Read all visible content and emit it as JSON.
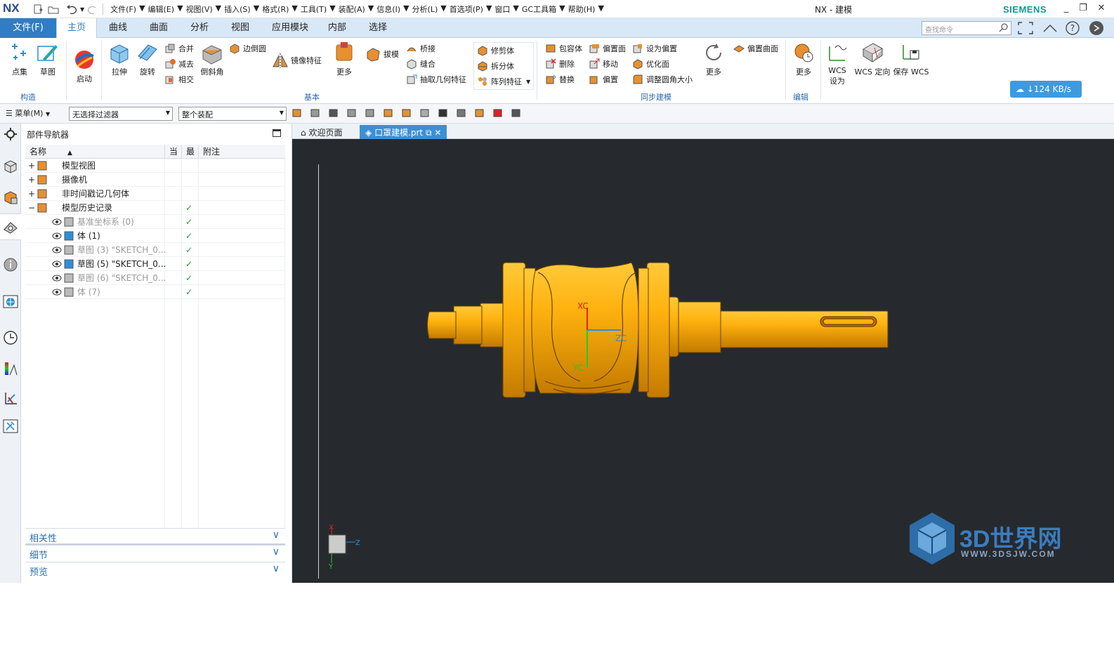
{
  "app": {
    "logo": "NX",
    "window_title": "NX - 建模",
    "brand": "SIEMENS"
  },
  "menu": [
    {
      "label": "文件(F)"
    },
    {
      "label": "编辑(E)"
    },
    {
      "label": "视图(V)"
    },
    {
      "label": "插入(S)"
    },
    {
      "label": "格式(R)"
    },
    {
      "label": "工具(T)"
    },
    {
      "label": "装配(A)"
    },
    {
      "label": "信息(I)"
    },
    {
      "label": "分析(L)"
    },
    {
      "label": "首选项(P)"
    },
    {
      "label": "窗口"
    },
    {
      "label": "GC工具箱"
    },
    {
      "label": "帮助(H)"
    }
  ],
  "tabs": [
    "文件(F)",
    "主页",
    "曲线",
    "曲面",
    "分析",
    "视图",
    "应用模块",
    "内部",
    "选择"
  ],
  "active_tab": "主页",
  "search": {
    "placeholder": "查找命令"
  },
  "ribbon": {
    "construct": {
      "point": "点集",
      "sketch": "草图",
      "group": "构造"
    },
    "launch": "启动",
    "base": {
      "extrude": "拉伸",
      "revolve": "旋转",
      "unite": "合并",
      "subtract": "减去",
      "intersect": "相交",
      "chamfer": "倒斜角",
      "edge_blend": "边倒圆",
      "mirror": "镜像特征",
      "more": "更多",
      "draft": "拔模",
      "bridge": "桥接",
      "sew": "缝合",
      "extract": "抽取几何特征",
      "trim": "修剪体",
      "split": "拆分体",
      "pattern": "阵列特征",
      "group": "基本"
    },
    "sync": {
      "wrap": "包容体",
      "offset_face": "偏置面",
      "set_offset": "设为偏置",
      "delete": "删除",
      "move": "移动",
      "optimize": "优化面",
      "replace": "替换",
      "offset": "偏置",
      "resize_blend": "调整圆角大小",
      "more": "更多",
      "offset_surface": "偏置曲面",
      "group": "同步建模"
    },
    "edit": {
      "more": "更多",
      "group": "编辑"
    },
    "wcs": {
      "set": "WCS 设为",
      "orient": "WCS 定向",
      "save": "保存 WCS"
    }
  },
  "netspeed": "124 KB/s",
  "toolbar2": {
    "menu": "菜单(M)",
    "filter": "无选择过滤器",
    "scope": "整个装配"
  },
  "navigator": {
    "title": "部件导航器",
    "columns": [
      "名称",
      "当",
      "最",
      "附注"
    ],
    "rows": [
      {
        "expander": "+",
        "name": "模型视图",
        "muted": false,
        "latest": false,
        "indent": 0
      },
      {
        "expander": "+",
        "name": "摄像机",
        "muted": false,
        "latest": false,
        "indent": 0
      },
      {
        "expander": "+",
        "name": "非时间戳记几何体",
        "muted": false,
        "latest": false,
        "indent": 0
      },
      {
        "expander": "−",
        "name": "模型历史记录",
        "muted": false,
        "latest": true,
        "indent": 0
      },
      {
        "expander": "",
        "name": "基准坐标系 (0)",
        "muted": true,
        "latest": true,
        "indent": 1
      },
      {
        "expander": "",
        "name": "体 (1)",
        "muted": false,
        "latest": true,
        "indent": 1
      },
      {
        "expander": "",
        "name": "草图 (3) \"SKETCH_0...",
        "muted": true,
        "latest": true,
        "indent": 1
      },
      {
        "expander": "",
        "name": "草图 (5) \"SKETCH_0...",
        "muted": false,
        "latest": true,
        "indent": 1
      },
      {
        "expander": "",
        "name": "草图 (6) \"SKETCH_0...",
        "muted": true,
        "latest": true,
        "indent": 1
      },
      {
        "expander": "",
        "name": "体 (7)",
        "muted": true,
        "latest": true,
        "indent": 1
      }
    ],
    "panels": [
      "相关性",
      "细节",
      "预览"
    ]
  },
  "doctabs": [
    "欢迎页面",
    "口罩建模.prt"
  ],
  "axes": {
    "xc": "XC",
    "yc": "YC",
    "zc": "ZC",
    "x": "X",
    "y": "Y",
    "z": "Z"
  },
  "watermark": {
    "title": "3D世界网",
    "url": "WWW.3DSJW.COM"
  }
}
